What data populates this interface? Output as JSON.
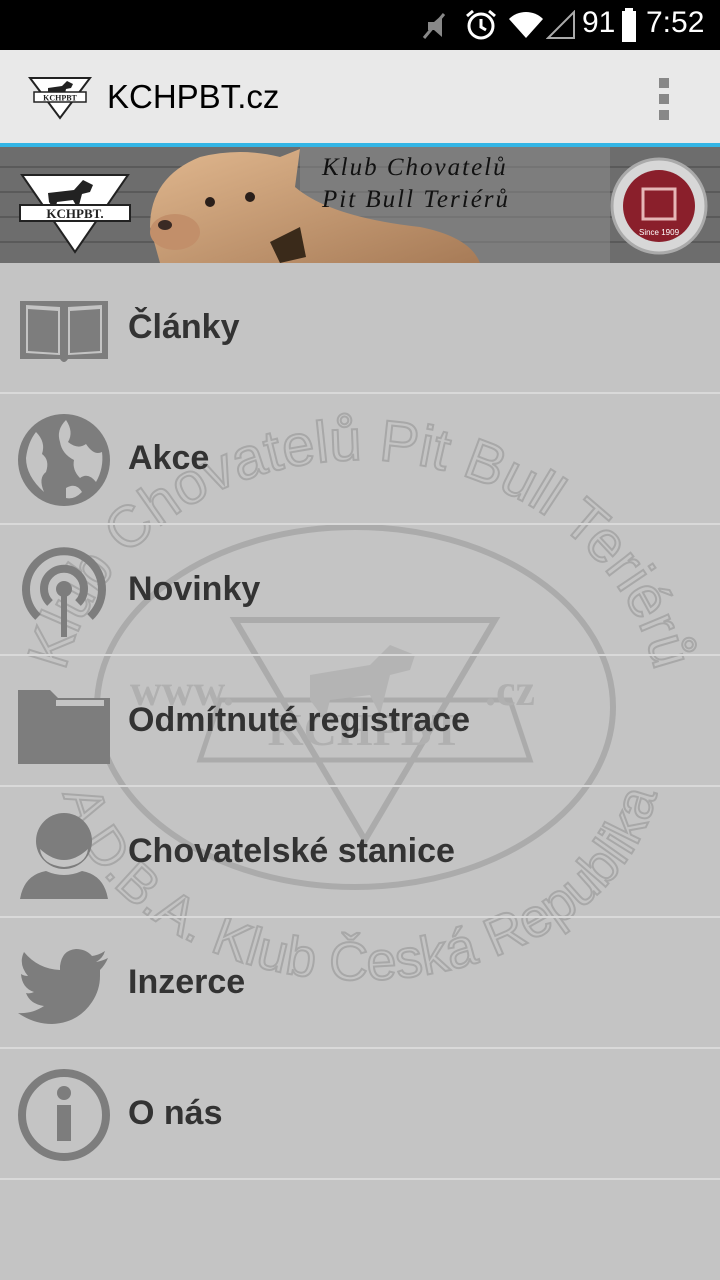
{
  "status_bar": {
    "battery_level": "91",
    "time": "7:52",
    "icons": [
      "muted-icon",
      "alarm-icon",
      "wifi-icon",
      "signal-icon",
      "battery-icon"
    ]
  },
  "action_bar": {
    "title": "KCHPBT.cz",
    "logo_text": "KCHPBT",
    "overflow_icon": "overflow-menu-icon"
  },
  "banner": {
    "logo_text": "KCHPBT.",
    "title_line1": "Klub Chovatelů",
    "title_line2": "Pit Bull Teriérů",
    "seal_text": "Since 1909"
  },
  "menu": {
    "items": [
      {
        "label": "Články",
        "icon": "book-icon"
      },
      {
        "label": "Akce",
        "icon": "globe-icon"
      },
      {
        "label": "Novinky",
        "icon": "podcast-icon"
      },
      {
        "label": "Odmítnuté registrace",
        "icon": "folder-icon"
      },
      {
        "label": "Chovatelské stanice",
        "icon": "person-icon"
      },
      {
        "label": "Inzerce",
        "icon": "twitter-icon"
      },
      {
        "label": "O nás",
        "icon": "info-icon"
      }
    ]
  },
  "watermark": {
    "top_text": "Klub Chovatelů Pit Bull Teriérů",
    "bottom_text": "A.D.B.A. Klub Česká Republika",
    "left_text": "www.",
    "right_text": ".cz",
    "center_text": "KCHPBT"
  },
  "colors": {
    "accent": "#33b5e5",
    "background": "#c4c4c4",
    "icon": "#7d7d7d",
    "label": "#333333"
  }
}
